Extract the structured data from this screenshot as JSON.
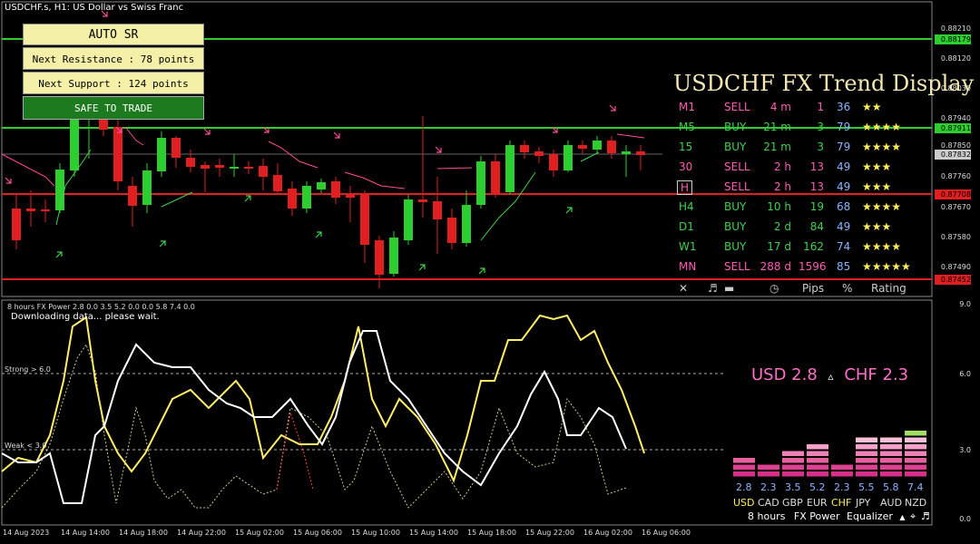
{
  "window": {
    "title": "USDCHF.s, H1:  US Dollar vs Swiss Franc"
  },
  "auto_sr": {
    "header": "AUTO  SR",
    "next_resistance": "Next Resistance : 78 points",
    "next_support": "Next Support : 124 points",
    "status": "SAFE TO TRADE"
  },
  "price_axis": {
    "labels": [
      "0.88210",
      "0.88179",
      "0.88120",
      "0.88030",
      "0.87940",
      "0.87911",
      "0.87850",
      "0.87832",
      "0.87760",
      "0.87708",
      "0.87670",
      "0.87580",
      "0.87490",
      "0.87452"
    ]
  },
  "trend_display": {
    "title": "USDCHF FX Trend Display",
    "rows": [
      {
        "tf": "M1",
        "signal": "SELL",
        "age": "4 m",
        "pips": "1",
        "pct": "36",
        "stars": "★★"
      },
      {
        "tf": "M5",
        "signal": "BUY",
        "age": "21 m",
        "pips": "3",
        "pct": "79",
        "stars": "★★★★"
      },
      {
        "tf": "15",
        "signal": "BUY",
        "age": "21 m",
        "pips": "3",
        "pct": "79",
        "stars": "★★★★"
      },
      {
        "tf": "30",
        "signal": "SELL",
        "age": "2 h",
        "pips": "13",
        "pct": "49",
        "stars": "★★★"
      },
      {
        "tf": "H",
        "signal": "SELL",
        "age": "2 h",
        "pips": "13",
        "pct": "49",
        "stars": "★★★"
      },
      {
        "tf": "H4",
        "signal": "BUY",
        "age": "10 h",
        "pips": "19",
        "pct": "68",
        "stars": "★★★★"
      },
      {
        "tf": "D1",
        "signal": "BUY",
        "age": "2 d",
        "pips": "84",
        "pct": "49",
        "stars": "★★★"
      },
      {
        "tf": "W1",
        "signal": "BUY",
        "age": "17 d",
        "pips": "162",
        "pct": "74",
        "stars": "★★★★"
      },
      {
        "tf": "MN",
        "signal": "SELL",
        "age": "288 d",
        "pips": "1596",
        "pct": "85",
        "stars": "★★★★★"
      }
    ],
    "footer": {
      "close": "✕",
      "sound": "♬",
      "line": "▬",
      "clock": "◷",
      "pips": "Pips",
      "pct": "%",
      "rating": "Rating"
    },
    "colors": {
      "buy": "#3cd24a",
      "sell": "#ff5ab4",
      "value": "#8ab4ff",
      "star": "#ffee55"
    }
  },
  "indicator": {
    "header": "8 hours FX Power 2.8 0.0 3.5 5.2 0.0 0.0 5.8 7.4 0.0",
    "status": "Downloading data... please wait.",
    "strong": "Strong > 6.0",
    "weak": "Weak < 3.0",
    "axis_labels": [
      "9.0",
      "6.0",
      "3.0",
      "0.0"
    ],
    "pair_strength": {
      "usd": "USD 2.8",
      "arrow": "▵",
      "chf": "CHF 2.3"
    },
    "equalizer": [
      {
        "currency": "USD",
        "value": "2.8",
        "bars": 2.8
      },
      {
        "currency": "CAD",
        "value": "2.3",
        "bars": 2.3
      },
      {
        "currency": "GBP",
        "value": "3.5",
        "bars": 3.5
      },
      {
        "currency": "EUR",
        "value": "5.2",
        "bars": 5.2
      },
      {
        "currency": "CHF",
        "value": "2.3",
        "bars": 2.3
      },
      {
        "currency": "JPY",
        "value": "5.5",
        "bars": 5.5
      },
      {
        "currency": "AUD",
        "value": "5.8",
        "bars": 5.8
      },
      {
        "currency": "NZD",
        "value": "7.4",
        "bars": 7.4
      }
    ],
    "footer": {
      "period": "8 hours",
      "name": "FX Power",
      "mode": "Equalizer",
      "up": "▲",
      "target": "⌖",
      "sound": "♬"
    }
  },
  "time_axis": [
    "14 Aug 2023",
    "14 Aug 14:00",
    "14 Aug 18:00",
    "14 Aug 22:00",
    "15 Aug 02:00",
    "15 Aug 06:00",
    "15 Aug 10:00",
    "15 Aug 14:00",
    "15 Aug 18:00",
    "15 Aug 22:00",
    "16 Aug 02:00",
    "16 Aug 06:00"
  ]
}
